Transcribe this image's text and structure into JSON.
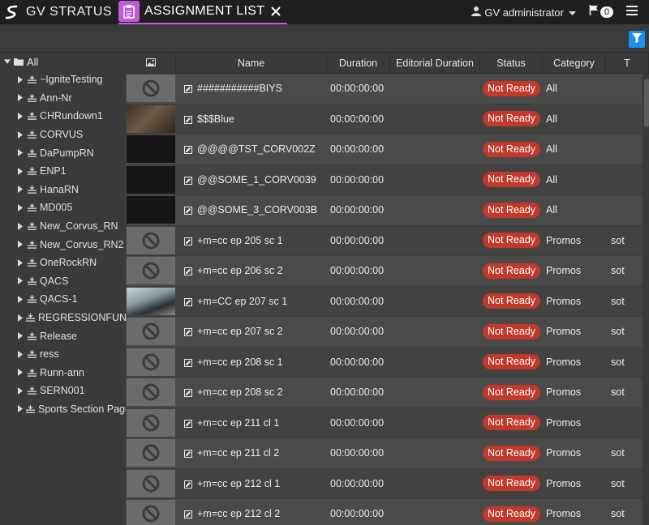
{
  "app": {
    "brand_name": "GV STRATUS",
    "tab_label": "ASSIGNMENT LIST",
    "accent_color": "#c25bd9"
  },
  "header": {
    "user_label": "GV administrator",
    "notification_count": "0",
    "icons": [
      "stratus-logo-icon",
      "clipboard-icon",
      "close-icon",
      "user-icon",
      "chevron-down-icon",
      "flag-icon",
      "hamburger-menu-icon",
      "filter-icon"
    ]
  },
  "sidebar": {
    "root_label": "All",
    "items": [
      {
        "label": "~IgniteTesting"
      },
      {
        "label": "Ann-Nr"
      },
      {
        "label": "CHRundown1"
      },
      {
        "label": "CORVUS"
      },
      {
        "label": "DaPumpRN"
      },
      {
        "label": "ENP1"
      },
      {
        "label": "HanaRN"
      },
      {
        "label": "MD005"
      },
      {
        "label": "New_Corvus_RN"
      },
      {
        "label": "New_Corvus_RN2"
      },
      {
        "label": "OneRockRN"
      },
      {
        "label": "QACS"
      },
      {
        "label": "QACS-1"
      },
      {
        "label": "REGRESSIONFUN"
      },
      {
        "label": "Release"
      },
      {
        "label": "ress"
      },
      {
        "label": "Runn-ann"
      },
      {
        "label": "SERN001"
      },
      {
        "label": "Sports Section Page"
      }
    ]
  },
  "grid": {
    "columns": {
      "name": "Name",
      "duration": "Duration",
      "editorial_duration": "Editorial Duration",
      "status": "Status",
      "category": "Category",
      "t": "T"
    },
    "status_color": "#c0392b",
    "rows": [
      {
        "thumb": "none",
        "name": "###########BIYS",
        "duration": "00:00:00:00",
        "status": "Not Ready",
        "category": "All",
        "t": ""
      },
      {
        "thumb": "photo",
        "name": "$$$Blue",
        "duration": "00:00:00:00",
        "status": "Not Ready",
        "category": "All",
        "t": ""
      },
      {
        "thumb": "dark",
        "name": "@@@@TST_CORV002Z",
        "duration": "00:00:00:00",
        "status": "Not Ready",
        "category": "All",
        "t": ""
      },
      {
        "thumb": "dark",
        "name": "@@SOME_1_CORV0039",
        "duration": "00:00:00:00",
        "status": "Not Ready",
        "category": "All",
        "t": ""
      },
      {
        "thumb": "dark",
        "name": "@@SOME_3_CORV003B",
        "duration": "00:00:00:00",
        "status": "Not Ready",
        "category": "All",
        "t": ""
      },
      {
        "thumb": "none",
        "name": "+m=cc ep 205 sc 1",
        "duration": "00:00:00:00",
        "status": "Not Ready",
        "category": "Promos",
        "t": "sot"
      },
      {
        "thumb": "none",
        "name": "+m=cc ep 206 sc 2",
        "duration": "00:00:00:00",
        "status": "Not Ready",
        "category": "Promos",
        "t": "sot"
      },
      {
        "thumb": "photo2",
        "name": "+m=CC ep 207 sc 1",
        "duration": "00:00:00:00",
        "status": "Not Ready",
        "category": "Promos",
        "t": "sot"
      },
      {
        "thumb": "none",
        "name": "+m=cc ep 207 sc 2",
        "duration": "00:00:00:00",
        "status": "Not Ready",
        "category": "Promos",
        "t": "sot"
      },
      {
        "thumb": "none",
        "name": "+m=cc ep 208 sc 1",
        "duration": "00:00:00:00",
        "status": "Not Ready",
        "category": "Promos",
        "t": "sot"
      },
      {
        "thumb": "none",
        "name": "+m=cc ep 208 sc 2",
        "duration": "00:00:00:00",
        "status": "Not Ready",
        "category": "Promos",
        "t": "sot"
      },
      {
        "thumb": "none",
        "name": "+m=cc ep 211 cl 1",
        "duration": "00:00:00:00",
        "status": "Not Ready",
        "category": "Promos",
        "t": ""
      },
      {
        "thumb": "none",
        "name": "+m=cc ep 211 cl 2",
        "duration": "00:00:00:00",
        "status": "Not Ready",
        "category": "Promos",
        "t": "sot"
      },
      {
        "thumb": "none",
        "name": "+m=cc ep 212 cl 1",
        "duration": "00:00:00:00",
        "status": "Not Ready",
        "category": "Promos",
        "t": "sot"
      },
      {
        "thumb": "none",
        "name": "+m=cc ep 212 cl 2",
        "duration": "00:00:00:00",
        "status": "Not Ready",
        "category": "Promos",
        "t": "sot"
      }
    ]
  }
}
